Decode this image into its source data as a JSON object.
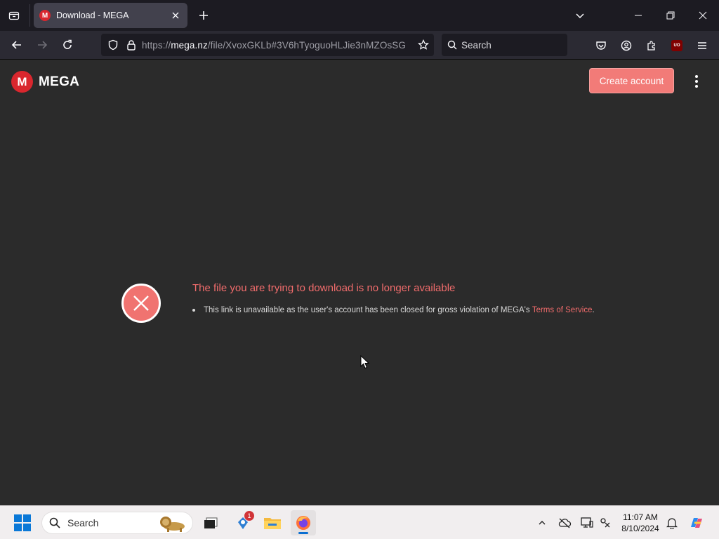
{
  "browser": {
    "tab": {
      "title": "Download - MEGA",
      "favicon": "M"
    },
    "url": {
      "prefix": "https://",
      "host": "mega.nz",
      "path": "/file/XvoxGKLb#3V6hTyoguoHLJie3nMZOsSG"
    },
    "search": {
      "placeholder": "Search"
    },
    "extension_label": "UO"
  },
  "page": {
    "logo": {
      "mark": "M",
      "wordmark": "MEGA"
    },
    "create_account_label": "Create account",
    "error": {
      "title": "The file you are trying to download is no longer available",
      "message": "This link is unavailable as the user's account has been closed for gross violation of MEGA's ",
      "link_text": "Terms of Service",
      "trailing": "."
    }
  },
  "taskbar": {
    "search_label": "Search",
    "notification_count": "1",
    "time": "11:07 AM",
    "date": "8/10/2024"
  },
  "colors": {
    "accent": "#f27b78",
    "error_text": "#f16c6c",
    "mega_red": "#d9272e"
  }
}
